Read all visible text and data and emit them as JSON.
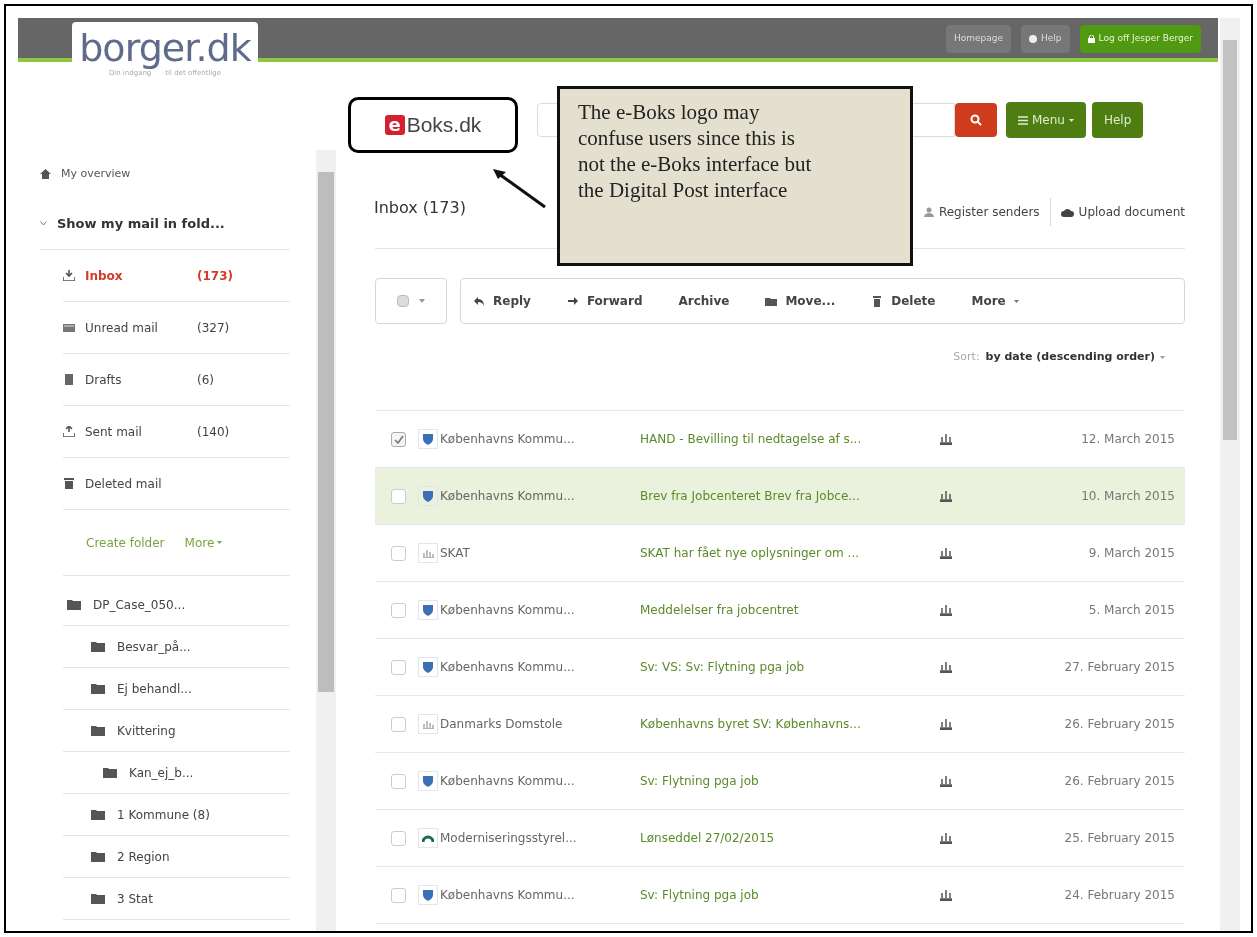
{
  "header": {
    "logo": "borger.dk",
    "tagline": [
      "Din indgang",
      "til det offentlige"
    ],
    "links": [
      {
        "label": "Homepage",
        "kind": "plain"
      },
      {
        "label": "Help",
        "kind": "help"
      },
      {
        "label": "Log off Jesper Berger",
        "kind": "logoff"
      }
    ]
  },
  "brand": {
    "logo_mark": "e",
    "logo_text": "Boks.dk"
  },
  "top_buttons": [
    {
      "label": "Menu",
      "kind": "menu"
    },
    {
      "label": "Help",
      "kind": "plain"
    }
  ],
  "callout": {
    "text": "The e-Boks logo may\nconfuse users since this is\nnot the e-Boks interface but\nthe Digital Post interface"
  },
  "sidebar": {
    "overview": "My overview",
    "section": "Show my mail in fold...",
    "mail_folders": [
      {
        "label": "Inbox",
        "count": "(173)",
        "kind": "inbox",
        "selected": true
      },
      {
        "label": "Unread mail",
        "count": "(327)",
        "kind": "unread",
        "selected": false
      },
      {
        "label": "Drafts",
        "count": "(6)",
        "kind": "drafts",
        "selected": false
      },
      {
        "label": "Sent mail",
        "count": "(140)",
        "kind": "sent",
        "selected": false
      },
      {
        "label": "Deleted mail",
        "kind": "deleted",
        "selected": false
      }
    ],
    "actions": [
      "Create folder",
      "More"
    ],
    "folders": [
      {
        "label": "DP_Case_050...",
        "children": [
          {
            "label": "Besvar_på..."
          },
          {
            "label": "Ej behandl..."
          },
          {
            "label": "Kvittering",
            "children": [
              {
                "label": "Kan_ej_b..."
              }
            ]
          },
          {
            "label": "1 Kommune (8)"
          },
          {
            "label": "2 Region"
          },
          {
            "label": "3 Stat"
          }
        ]
      }
    ]
  },
  "inbox": {
    "title": "Inbox (173)",
    "links": [
      {
        "label": "Register senders",
        "kind": "person"
      },
      {
        "label": "Upload document",
        "kind": "cloud"
      }
    ],
    "toolbar": [
      {
        "label": "Reply",
        "kind": "reply"
      },
      {
        "label": "Forward",
        "kind": "forward"
      },
      {
        "label": "Archive",
        "kind": "none"
      },
      {
        "label": "Move...",
        "kind": "move"
      },
      {
        "label": "Delete",
        "kind": "delete"
      },
      {
        "label": "More",
        "kind": "dropdown"
      }
    ],
    "sort_label": "Sort:",
    "sort_value": "by date (descending order)",
    "rows": [
      {
        "checked": true,
        "selected": false,
        "kind": "crest",
        "sender": "Københavns Kommu...",
        "subject": "HAND - Bevilling til nedtagelse af s...",
        "date": "12. March 2015"
      },
      {
        "checked": false,
        "selected": true,
        "kind": "crest",
        "sender": "Københavns Kommu...",
        "subject": "Brev fra Jobcenteret Brev fra Jobce...",
        "date": "10. March 2015"
      },
      {
        "checked": false,
        "selected": false,
        "kind": "plain",
        "sender": "SKAT",
        "subject": "SKAT har fået nye oplysninger om ...",
        "date": "9. March 2015"
      },
      {
        "checked": false,
        "selected": false,
        "kind": "crest",
        "sender": "Københavns Kommu...",
        "subject": "Meddelelser fra jobcentret",
        "date": "5. March 2015"
      },
      {
        "checked": false,
        "selected": false,
        "kind": "crest",
        "sender": "Københavns Kommu...",
        "subject": "Sv: VS: Sv: Flytning pga job",
        "date": "27. February 2015"
      },
      {
        "checked": false,
        "selected": false,
        "kind": "plain",
        "sender": "Danmarks Domstole",
        "subject": "Københavns byret SV: Københavns...",
        "date": "26. February 2015"
      },
      {
        "checked": false,
        "selected": false,
        "kind": "crest",
        "sender": "Københavns Kommu...",
        "subject": "Sv: Flytning pga job",
        "date": "26. February 2015"
      },
      {
        "checked": false,
        "selected": false,
        "kind": "arc",
        "sender": "Moderniseringsstyrel...",
        "subject": "Lønseddel 27/02/2015",
        "date": "25. February 2015"
      },
      {
        "checked": false,
        "selected": false,
        "kind": "crest",
        "sender": "Københavns Kommu...",
        "subject": "Sv: Flytning pga job",
        "date": "24. February 2015"
      }
    ]
  }
}
